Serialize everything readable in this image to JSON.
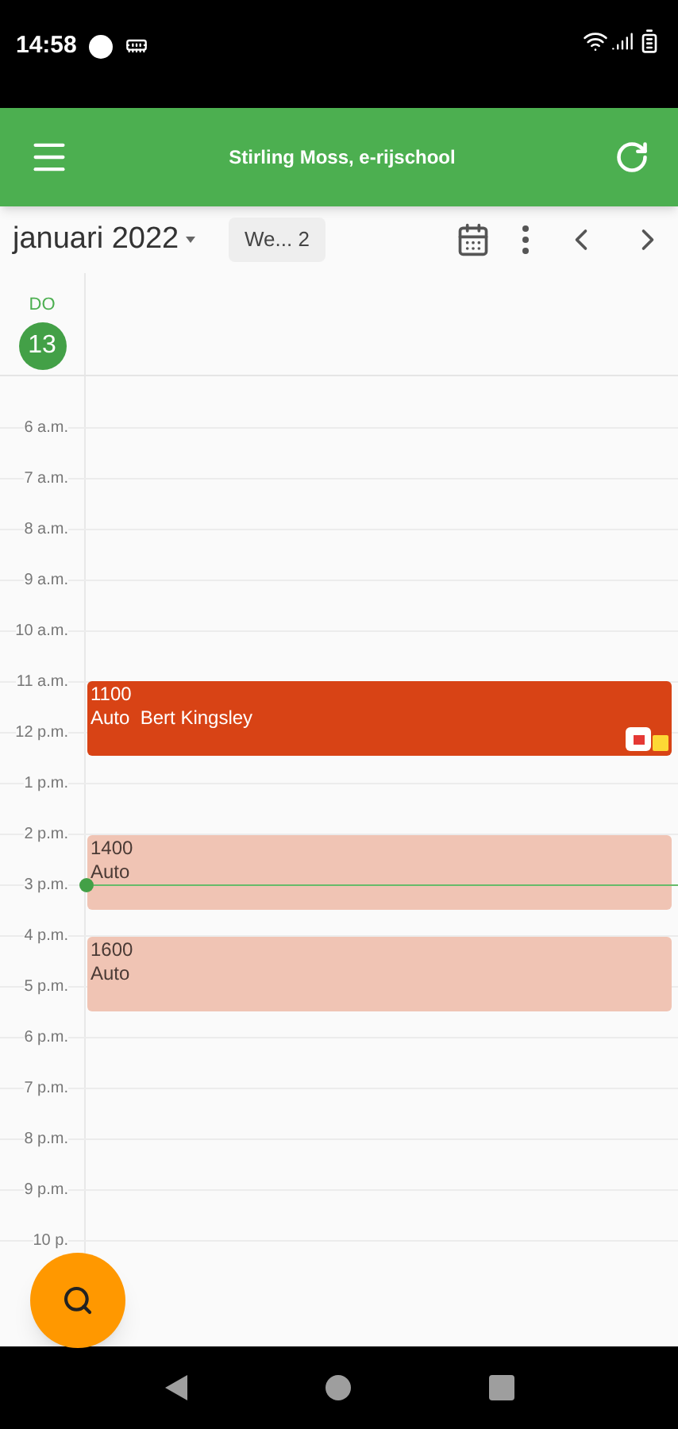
{
  "status_bar": {
    "time": "14:58"
  },
  "app_bar": {
    "title": "Stirling Moss, e-rijschool"
  },
  "toolbar": {
    "month": "januari 2022",
    "view": "We... 2"
  },
  "day": {
    "weekday": "DO",
    "date": "13",
    "today": true
  },
  "hours": [
    "6 a.m.",
    "7 a.m.",
    "8 a.m.",
    "9 a.m.",
    "10 a.m.",
    "11 a.m.",
    "12 p.m.",
    "1 p.m.",
    "2 p.m.",
    "3 p.m.",
    "4 p.m.",
    "5 p.m.",
    "6 p.m.",
    "7 p.m.",
    "8 p.m.",
    "9 p.m.",
    "10 p."
  ],
  "events": [
    {
      "time": "1100",
      "title": "Auto  Bert Kingsley",
      "kind": "booked",
      "color": "#d84315",
      "flagged": true,
      "has_note": true
    },
    {
      "time": "1400",
      "title": "Auto",
      "kind": "open",
      "color": "#f0c4b4",
      "flagged": false,
      "has_note": false
    },
    {
      "time": "1600",
      "title": "Auto",
      "kind": "open",
      "color": "#f0c4b4",
      "flagged": false,
      "has_note": false
    }
  ]
}
